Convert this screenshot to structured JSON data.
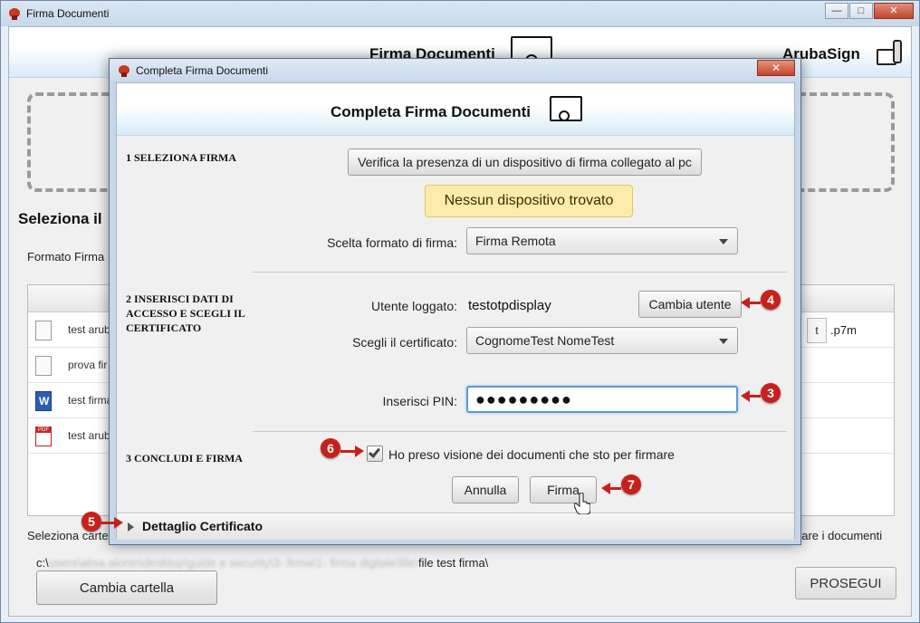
{
  "main_window": {
    "title": "Firma Documenti",
    "header_title": "Firma Documenti",
    "brand": "ArubaSign",
    "seleziona_label": "Seleziona il",
    "formato_label": "Formato Firma",
    "files": [
      {
        "name": "test arub",
        "icon": "document-icon"
      },
      {
        "name": "prova fir",
        "icon": "document-icon"
      },
      {
        "name": "test firma",
        "icon": "word-icon"
      },
      {
        "name": "test arub",
        "icon": "pdf-icon"
      }
    ],
    "ext_box": "t",
    "ext_text": ".p7m",
    "seleziona_cartella": "Seleziona carte",
    "firmare_text": "nare i documenti",
    "path_prefix": "c:\\",
    "path_blur": "users\\alisa.alonin\\desktop\\guide e security\\3- firma\\1- firma digitale\\file\\",
    "path_suffix": "file test firma\\",
    "cambia_cartella": "Cambia cartella",
    "prosegui": "PROSEGUI"
  },
  "dialog": {
    "title": "Completa Firma Documenti",
    "header_title": "Completa Firma Documenti",
    "section1": "1 SELEZIONA FIRMA",
    "verifica_button": "Verifica la presenza di un dispositivo di firma collegato al pc",
    "alert": "Nessun dispositivo trovato",
    "formato_label": "Scelta formato di firma:",
    "formato_value": "Firma Remota",
    "section2": "2 INSERISCI DATI DI ACCESSO E SCEGLI IL CERTIFICATO",
    "utente_label": "Utente loggato:",
    "utente_value": "testotpdisplay",
    "cambia_utente": "Cambia utente",
    "certificato_label": "Scegli il certificato:",
    "certificato_value": "CognomeTest NomeTest",
    "pin_label": "Inserisci PIN:",
    "pin_value": "●●●●●●●●●",
    "section3": "3 CONCLUDI E FIRMA",
    "checkbox_label": "Ho preso visione dei documenti che sto per firmare",
    "annulla": "Annulla",
    "firma": "Firma",
    "dettaglio": "Dettaglio Certificato"
  },
  "annotations": {
    "badge_3": "3",
    "badge_4": "4",
    "badge_5": "5",
    "badge_6": "6",
    "badge_7": "7",
    "color": "#c8201c"
  },
  "window_controls": {
    "minimize": "—",
    "maximize": "□",
    "close": "✕"
  }
}
